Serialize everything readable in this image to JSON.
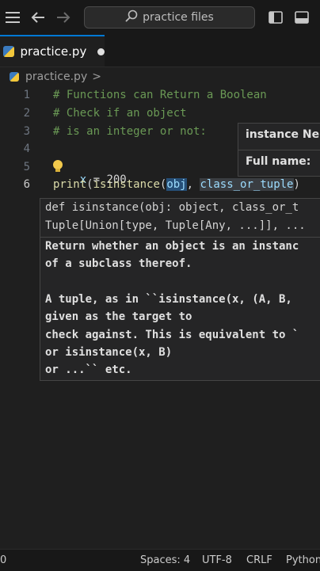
{
  "search": {
    "placeholder": "practice files"
  },
  "tab": {
    "label": "practice.py"
  },
  "breadcrumb": {
    "file": "practice.py",
    "sep": ">"
  },
  "code": {
    "line_numbers": [
      "1",
      "2",
      "3",
      "4",
      "5",
      "6"
    ],
    "line1": "# Functions can Return a Boolean",
    "line2": "# Check if an object",
    "line3": "# is an integer or not:",
    "line5": {
      "var": "x",
      "rest": " = 200"
    },
    "line6": {
      "fn": "print",
      "open": "(",
      "fn2": "isinstance",
      "open2": "(",
      "arg1": "obj",
      "comma": ", ",
      "arg2": "class_or_tuple",
      "close": ")"
    }
  },
  "hover": {
    "line1": "instance Ne",
    "line2": "Full name:"
  },
  "signature": {
    "line1": "def isinstance(obj: object, class_or_t",
    "line2": "Tuple[Union[type, Tuple[Any, ...]], ...",
    "doc": [
      "Return whether an object is an instanc",
      "of a subclass thereof.",
      "",
      "A tuple, as in ``isinstance(x, (A, B,",
      "given as the target to",
      "check against. This is equivalent to `",
      "or isinstance(x, B)",
      "or ...`` etc."
    ]
  },
  "status": {
    "left": "0",
    "spaces": "Spaces: 4",
    "encoding": "UTF-8",
    "eol": "CRLF",
    "language": "Python"
  }
}
